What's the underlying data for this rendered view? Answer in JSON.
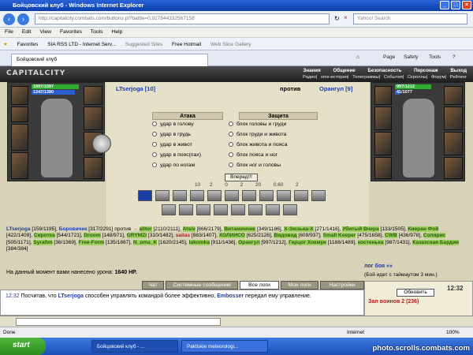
{
  "window": {
    "title": "Бойцовский клуб - Windows Internet Explorer"
  },
  "address": {
    "url": "http://capitalcity.combats.com/buttons.pl?battle=0,927844332567158",
    "search_placeholder": "Yahoo! Search"
  },
  "menu": [
    "File",
    "Edit",
    "View",
    "Favorites",
    "Tools",
    "Help"
  ],
  "favorites_bar": [
    "Favorites",
    "SIA RSS LTD - Internet Serv...",
    "Suggested Sites",
    "Free Hotmail",
    "Web Slice Gallery"
  ],
  "tab": {
    "label": "Бойцовский клуб"
  },
  "ie_tools": [
    "Page",
    "Safety",
    "Tools"
  ],
  "game": {
    "logo": "CAPITALCITY",
    "nav_top": [
      "Знания",
      "Общение",
      "Безопасность",
      "Персонаж",
      "Выход"
    ],
    "nav_bottom": [
      "Радио",
      "sms-история",
      "Телеграммы",
      "События",
      "Скроллы",
      "Форум",
      "Рейтинг"
    ]
  },
  "fighter_left": {
    "name": "LTserjoga [10]",
    "hp": "1597/1597",
    "mp": "1247/1390"
  },
  "fighter_right": {
    "name": "Орангул [9]",
    "hp": "997/1212",
    "mp": "41/1077"
  },
  "versus": "против",
  "attack": {
    "header": "Атака",
    "options": [
      "удар в голову",
      "удар в грудь",
      "удар в живот",
      "удар в пояс(пах)",
      "удар по ногам"
    ]
  },
  "defense": {
    "header": "Защита",
    "options": [
      "блок головы и груди",
      "блок груди и живота",
      "блок живота и пояса",
      "блок пояса и ног",
      "блок ног и головы"
    ]
  },
  "forward_button": "Вперед!!!",
  "stats": [
    "10",
    "2",
    "0",
    "2",
    "20",
    "0.60",
    "2"
  ],
  "damage": {
    "label": "На данный момент вами нанесено урона:",
    "value": "1640 HP."
  },
  "log_link": "лог боя »»",
  "timeout": "(Бой идет с таймаутом 3 мин.)",
  "chat_tabs": [
    "Чат",
    "Системные сообщения",
    "Все логи",
    "Мои логи",
    "Настройки"
  ],
  "chat": {
    "time": "12:32",
    "text1": "Посчитав, что",
    "name1": "LTserjoga",
    "text2": "способен управлять командой более эффективно,",
    "name2": "Embosser",
    "text3": "передал ему управление."
  },
  "right_panel": {
    "button": "Обновить",
    "room": "Зал воинов 2 (236)",
    "clock": "12:32"
  },
  "statusbar": {
    "left": "Done",
    "zone": "Internet",
    "zoom": "100%"
  },
  "taskbar": {
    "start": "start",
    "tasks": [
      "Бойцовский клуб - ...",
      "Paktiskie meteorologi..."
    ],
    "watermark": "photo.scrolls.combats.com"
  },
  "roster": [
    {
      "t": "n",
      "v": "LTserjoga"
    },
    {
      "t": "p",
      "v": " [159/1195], "
    },
    {
      "t": "n",
      "v": "Боровичек"
    },
    {
      "t": "p",
      "v": " [317/2291] "
    },
    {
      "t": "p",
      "v": "против"
    },
    {
      "t": "r",
      "v": " → "
    },
    {
      "t": "g",
      "v": "alltor"
    },
    {
      "t": "p",
      "v": " [2110/2111], "
    },
    {
      "t": "g",
      "v": "Atsiv"
    },
    {
      "t": "p",
      "v": " [866/2179], "
    },
    {
      "t": "g",
      "v": "Витаминчик"
    },
    {
      "t": "p",
      "v": " [349/1186], "
    },
    {
      "t": "g",
      "v": "X-Зюзька-X"
    },
    {
      "t": "p",
      "v": " [271/1416], "
    },
    {
      "t": "g",
      "v": "Убитый Вчера"
    },
    {
      "t": "p",
      "v": " [133/1505], "
    },
    {
      "t": "g",
      "v": "Киеран Фой"
    },
    {
      "t": "p",
      "v": " [422/1409], "
    },
    {
      "t": "g",
      "v": "Сиротка"
    },
    {
      "t": "p",
      "v": " [544/1721], "
    },
    {
      "t": "g",
      "v": "Droom"
    },
    {
      "t": "p",
      "v": " [148/971], "
    },
    {
      "t": "g",
      "v": "GRYMZI"
    },
    {
      "t": "p",
      "v": " [310/1482], "
    },
    {
      "t": "r",
      "v": "sailas"
    },
    {
      "t": "p",
      "v": " [883/1407], "
    },
    {
      "t": "g",
      "v": "ХОЛИИСО"
    },
    {
      "t": "p",
      "v": " [625/2126], "
    },
    {
      "t": "g",
      "v": "Видовод"
    },
    {
      "t": "p",
      "v": " [609/937], "
    },
    {
      "t": "g",
      "v": "Small Keeper"
    },
    {
      "t": "p",
      "v": " [475/1658], "
    },
    {
      "t": "g",
      "v": "CWB"
    },
    {
      "t": "p",
      "v": " [436/978], "
    },
    {
      "t": "g",
      "v": "Солярис"
    },
    {
      "t": "p",
      "v": " [505/1171], "
    },
    {
      "t": "g",
      "v": "Syrafim"
    },
    {
      "t": "p",
      "v": " [36/1369], "
    },
    {
      "t": "g",
      "v": "Free-Form"
    },
    {
      "t": "p",
      "v": " [135/1867], "
    },
    {
      "t": "g",
      "v": "N_oma_K"
    },
    {
      "t": "p",
      "v": " [1620/2145], "
    },
    {
      "t": "g",
      "v": "lakomka"
    },
    {
      "t": "p",
      "v": " [911/1436], "
    },
    {
      "t": "g",
      "v": "Орангул"
    },
    {
      "t": "p",
      "v": " [997/1212], "
    },
    {
      "t": "g",
      "v": "Герцог Хокмун"
    },
    {
      "t": "p",
      "v": " [1188/1489], "
    },
    {
      "t": "g",
      "v": "костенька"
    },
    {
      "t": "p",
      "v": " [987/1431], "
    },
    {
      "t": "g",
      "v": "Казахская Бардия"
    },
    {
      "t": "p",
      "v": " [384/384]"
    }
  ]
}
